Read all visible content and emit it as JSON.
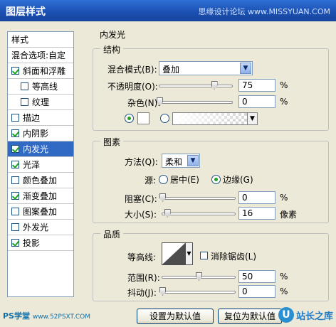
{
  "window": {
    "title": "图层样式",
    "watermark": "思缘设计论坛 www.MISSYUAN.COM"
  },
  "sidebar": {
    "header": "样式",
    "blend_options": "混合选项:自定",
    "items": [
      {
        "label": "斜面和浮雕",
        "checked": true,
        "indent": false,
        "selected": false
      },
      {
        "label": "等高线",
        "checked": false,
        "indent": true,
        "selected": false
      },
      {
        "label": "纹理",
        "checked": false,
        "indent": true,
        "selected": false
      },
      {
        "label": "描边",
        "checked": false,
        "indent": false,
        "selected": false
      },
      {
        "label": "内阴影",
        "checked": true,
        "indent": false,
        "selected": false
      },
      {
        "label": "内发光",
        "checked": true,
        "indent": false,
        "selected": true
      },
      {
        "label": "光泽",
        "checked": true,
        "indent": false,
        "selected": false
      },
      {
        "label": "颜色叠加",
        "checked": false,
        "indent": false,
        "selected": false
      },
      {
        "label": "渐变叠加",
        "checked": true,
        "indent": false,
        "selected": false
      },
      {
        "label": "图案叠加",
        "checked": false,
        "indent": false,
        "selected": false
      },
      {
        "label": "外发光",
        "checked": false,
        "indent": false,
        "selected": false
      },
      {
        "label": "投影",
        "checked": true,
        "indent": false,
        "selected": false
      }
    ]
  },
  "panel_title": "内发光",
  "structure": {
    "title": "结构",
    "blend_mode_label": "混合模式(B):",
    "blend_mode_value": "叠加",
    "opacity_label": "不透明度(O):",
    "opacity_value": "75",
    "opacity_fraction": 0.75,
    "noise_label": "杂色(N):",
    "noise_value": "0",
    "noise_fraction": 0,
    "unit": "%",
    "color_radio_selected": true,
    "gradient_radio_selected": false,
    "color_swatch": "#ffffff"
  },
  "elements": {
    "title": "图素",
    "method_label": "方法(Q):",
    "method_value": "柔和",
    "source_label": "源:",
    "source_center": "居中(E)",
    "source_edge": "边缘(G)",
    "source_selected": "edge",
    "choke_label": "阻塞(C):",
    "choke_value": "0",
    "choke_fraction": 0,
    "size_label": "大小(S):",
    "size_value": "16",
    "size_fraction": 0.065,
    "unit_pct": "%",
    "unit_px": "像素"
  },
  "quality": {
    "title": "品质",
    "contour_label": "等高线:",
    "antialias_label": "消除锯齿(L)",
    "antialias_checked": false,
    "range_label": "范围(R):",
    "range_value": "50",
    "range_fraction": 0.5,
    "jitter_label": "抖动(J):",
    "jitter_value": "0",
    "jitter_fraction": 0,
    "unit": "%"
  },
  "buttons": {
    "set_default": "设置为默认值",
    "reset_default": "复位为默认值"
  },
  "footer": {
    "left_brand": "PS学堂",
    "left_url": "www.52PSXT.COM",
    "right_logo": "U",
    "right_text": "站长之库"
  }
}
